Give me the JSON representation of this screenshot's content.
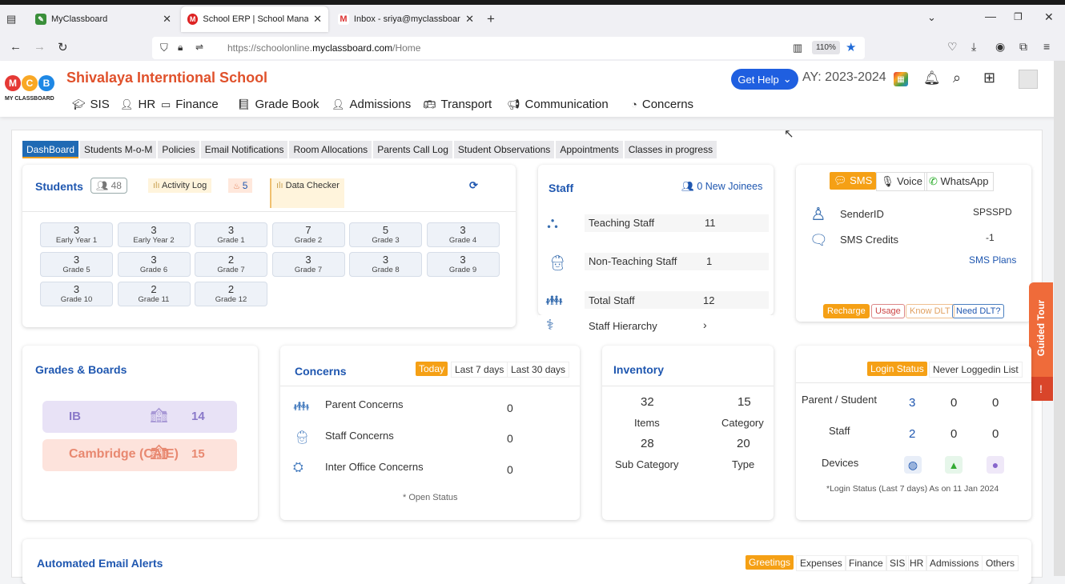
{
  "browser": {
    "tabs": [
      {
        "title": "MyClassboard",
        "close": "✕"
      },
      {
        "title": "School ERP | School Manageme",
        "close": "✕"
      },
      {
        "title": "Inbox - sriya@myclassboard.in",
        "close": "✕"
      }
    ],
    "new_tab": "+",
    "url_prefix": "https://schoolonline.",
    "url_domain": "myclassboard.com",
    "url_path": "/Home",
    "zoom": "110%"
  },
  "app": {
    "logo_letters": [
      "M",
      "C",
      "B"
    ],
    "logo_text": "MY CLASSBOARD",
    "school_name": "Shivalaya Interntional School",
    "get_help": "Get Help",
    "academic_year": "AY: 2023-2024",
    "nav": [
      "SIS",
      "HR",
      "Finance",
      "Grade Book",
      "Admissions",
      "Transport",
      "Communication",
      "Concerns"
    ]
  },
  "subtabs": [
    "DashBoard",
    "Students M-o-M",
    "Policies",
    "Email Notifications",
    "Room Allocations",
    "Parents Call Log",
    "Student Observations",
    "Appointments",
    "Classes in progress"
  ],
  "students": {
    "title": "Students",
    "count": "48",
    "activity_log": "Activity Log",
    "alert_count": "5",
    "data_checker": "Data Checker",
    "grades": [
      {
        "v": "3",
        "l": "Early Year 1"
      },
      {
        "v": "3",
        "l": "Early Year 2"
      },
      {
        "v": "3",
        "l": "Grade 1"
      },
      {
        "v": "7",
        "l": "Grade 2"
      },
      {
        "v": "5",
        "l": "Grade 3"
      },
      {
        "v": "3",
        "l": "Grade 4"
      },
      {
        "v": "3",
        "l": "Grade 5"
      },
      {
        "v": "3",
        "l": "Grade 6"
      },
      {
        "v": "2",
        "l": "Grade 7"
      },
      {
        "v": "3",
        "l": "Grade 7"
      },
      {
        "v": "3",
        "l": "Grade 8"
      },
      {
        "v": "3",
        "l": "Grade 9"
      },
      {
        "v": "3",
        "l": "Grade 10"
      },
      {
        "v": "2",
        "l": "Grade 11"
      },
      {
        "v": "2",
        "l": "Grade 12"
      }
    ]
  },
  "staff": {
    "title": "Staff",
    "new_joinees": "0 New Joinees",
    "rows": [
      {
        "label": "Teaching Staff",
        "value": "11"
      },
      {
        "label": "Non-Teaching Staff",
        "value": "1"
      },
      {
        "label": "Total Staff",
        "value": "12"
      }
    ],
    "hierarchy": "Staff Hierarchy"
  },
  "sms": {
    "tabs": [
      "SMS",
      "Voice",
      "WhatsApp"
    ],
    "sender_label": "SenderID",
    "sender_value": "SPSSPD",
    "credits_label": "SMS Credits",
    "credits_value": "-1",
    "plans": "SMS Plans",
    "buttons": [
      "Recharge",
      "Usage",
      "Know DLT",
      "Need DLT?"
    ]
  },
  "grades_boards": {
    "title": "Grades & Boards",
    "boards": [
      {
        "name": "IB",
        "count": "14"
      },
      {
        "name": "Cambridge (CAIE)",
        "count": "15"
      }
    ]
  },
  "concerns": {
    "title": "Concerns",
    "filters": [
      "Today",
      "Last 7 days",
      "Last 30 days"
    ],
    "rows": [
      {
        "label": "Parent Concerns",
        "value": "0"
      },
      {
        "label": "Staff Concerns",
        "value": "0"
      },
      {
        "label": "Inter Office Concerns",
        "value": "0"
      }
    ],
    "note": "* Open Status"
  },
  "inventory": {
    "title": "Inventory",
    "items_value": "32",
    "items_label": "Items",
    "category_value": "15",
    "category_label": "Category",
    "subcat_value": "28",
    "subcat_label": "Sub Category",
    "type_value": "20",
    "type_label": "Type"
  },
  "login": {
    "tabs": [
      "Login Status",
      "Never Loggedin List"
    ],
    "rows": [
      {
        "label": "Parent / Student",
        "a": "3",
        "b": "0",
        "c": "0"
      },
      {
        "label": "Staff",
        "a": "2",
        "b": "0",
        "c": "0"
      }
    ],
    "devices_label": "Devices",
    "note": "*Login Status (Last 7 days) As on 11 Jan 2024"
  },
  "guided_tour": "Guided Tour",
  "email_alerts": {
    "title": "Automated Email Alerts",
    "tabs": [
      "Greetings",
      "Expenses",
      "Finance",
      "SIS",
      "HR",
      "Admissions",
      "Others"
    ]
  }
}
